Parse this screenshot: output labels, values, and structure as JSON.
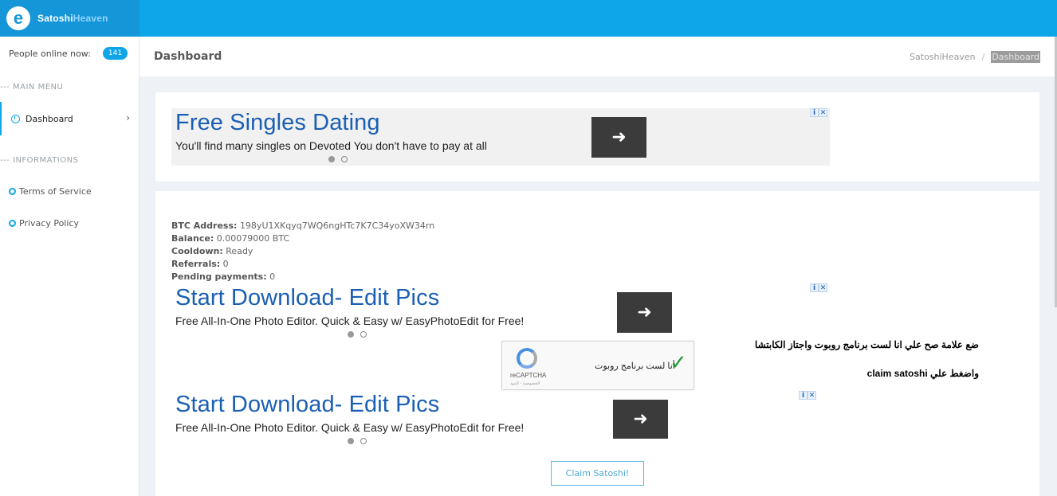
{
  "brand": {
    "logo_letter": "e",
    "name_part1": "Satoshi",
    "name_part2": "Heaven"
  },
  "sidebar": {
    "online_label": "People online now:",
    "online_count": "141",
    "main_menu_heading": "--- MAIN MENU",
    "dashboard_label": "Dashboard",
    "chevron": "›",
    "info_heading": "--- INFORMATIONS",
    "terms_label": "Terms of Service",
    "privacy_label": "Privacy Policy"
  },
  "header": {
    "title": "Dashboard",
    "breadcrumb_root": "SatoshiHeaven",
    "breadcrumb_sep": "/",
    "breadcrumb_current": "Dashboard"
  },
  "ads": {
    "top": {
      "headline": "Free Singles Dating",
      "text": "You'll find many singles on Devoted You don't have to pay at all",
      "arrow": "➜"
    },
    "mid": {
      "headline": "Start Download- Edit Pics",
      "text": "Free All-In-One Photo Editor. Quick & Easy w/ EasyPhotoEdit for Free!",
      "arrow": "➜"
    },
    "bottom": {
      "headline": "Start Download- Edit Pics",
      "text": "Free All-In-One Photo Editor. Quick & Easy w/ EasyPhotoEdit for Free!",
      "arrow": "➜"
    },
    "adchoice_i": "i",
    "adchoice_x": "✕"
  },
  "account": {
    "btc_label": "BTC Address:",
    "btc_value": "198yU1XKqyq7WQ6ngHTc7K7C34yoXW34rn",
    "balance_label": "Balance:",
    "balance_value": "0.00079000 BTC",
    "cooldown_label": "Cooldown:",
    "cooldown_value": "Ready",
    "referrals_label": "Referrals:",
    "referrals_value": "0",
    "pending_label": "Pending payments:",
    "pending_value": "0"
  },
  "captcha": {
    "label": "أنا لست برنامج روبوت",
    "brand": "reCAPTCHA",
    "privacy": "الخصوصية - البنود",
    "check": "✓"
  },
  "annotation": {
    "line1": "ضع علامة صح علي انا لست برنامج روبوت واجتاز الكابتشا",
    "line2": "واضغط علي claim satoshi"
  },
  "claim_button": "Claim Satoshi!",
  "colors": {
    "accent": "#0ea5e9",
    "ad_headline": "#1a5fb4",
    "check": "#1a9a2f"
  }
}
